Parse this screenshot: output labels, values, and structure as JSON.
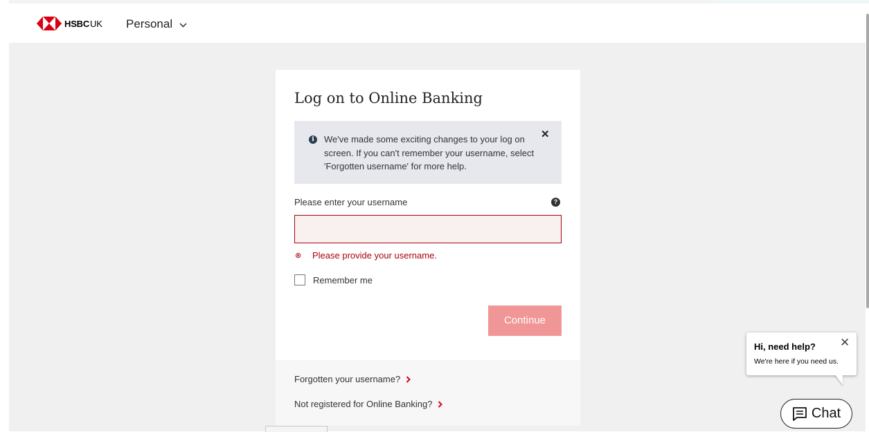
{
  "header": {
    "brand": "HSBC",
    "brand_region": "UK",
    "nav_label": "Personal"
  },
  "login": {
    "title": "Log on to Online Banking",
    "notice": "We've made some exciting changes to your log on screen. If you can't remember your username, select 'Forgotten username' for more help.",
    "username_label": "Please enter your username",
    "username_value": "",
    "error_text": "Please provide your username.",
    "remember_label": "Remember me",
    "remember_checked": false,
    "continue_label": "Continue"
  },
  "footer_links": [
    {
      "label": "Forgotten your username?"
    },
    {
      "label": "Not registered for Online Banking?"
    }
  ],
  "chat": {
    "bubble_title": "Hi, need help?",
    "bubble_text": "We're here if you need us.",
    "button_label": "Chat"
  },
  "colors": {
    "brand_red": "#db0011",
    "error_red": "#a8000b",
    "button_disabled": "#f09697",
    "page_bg": "#f0f0f0"
  },
  "icons": {
    "info": "info-icon",
    "help": "help-icon",
    "close": "close-icon",
    "error": "error-icon",
    "chevron": "chevron-right-icon",
    "chat": "chat-icon"
  }
}
